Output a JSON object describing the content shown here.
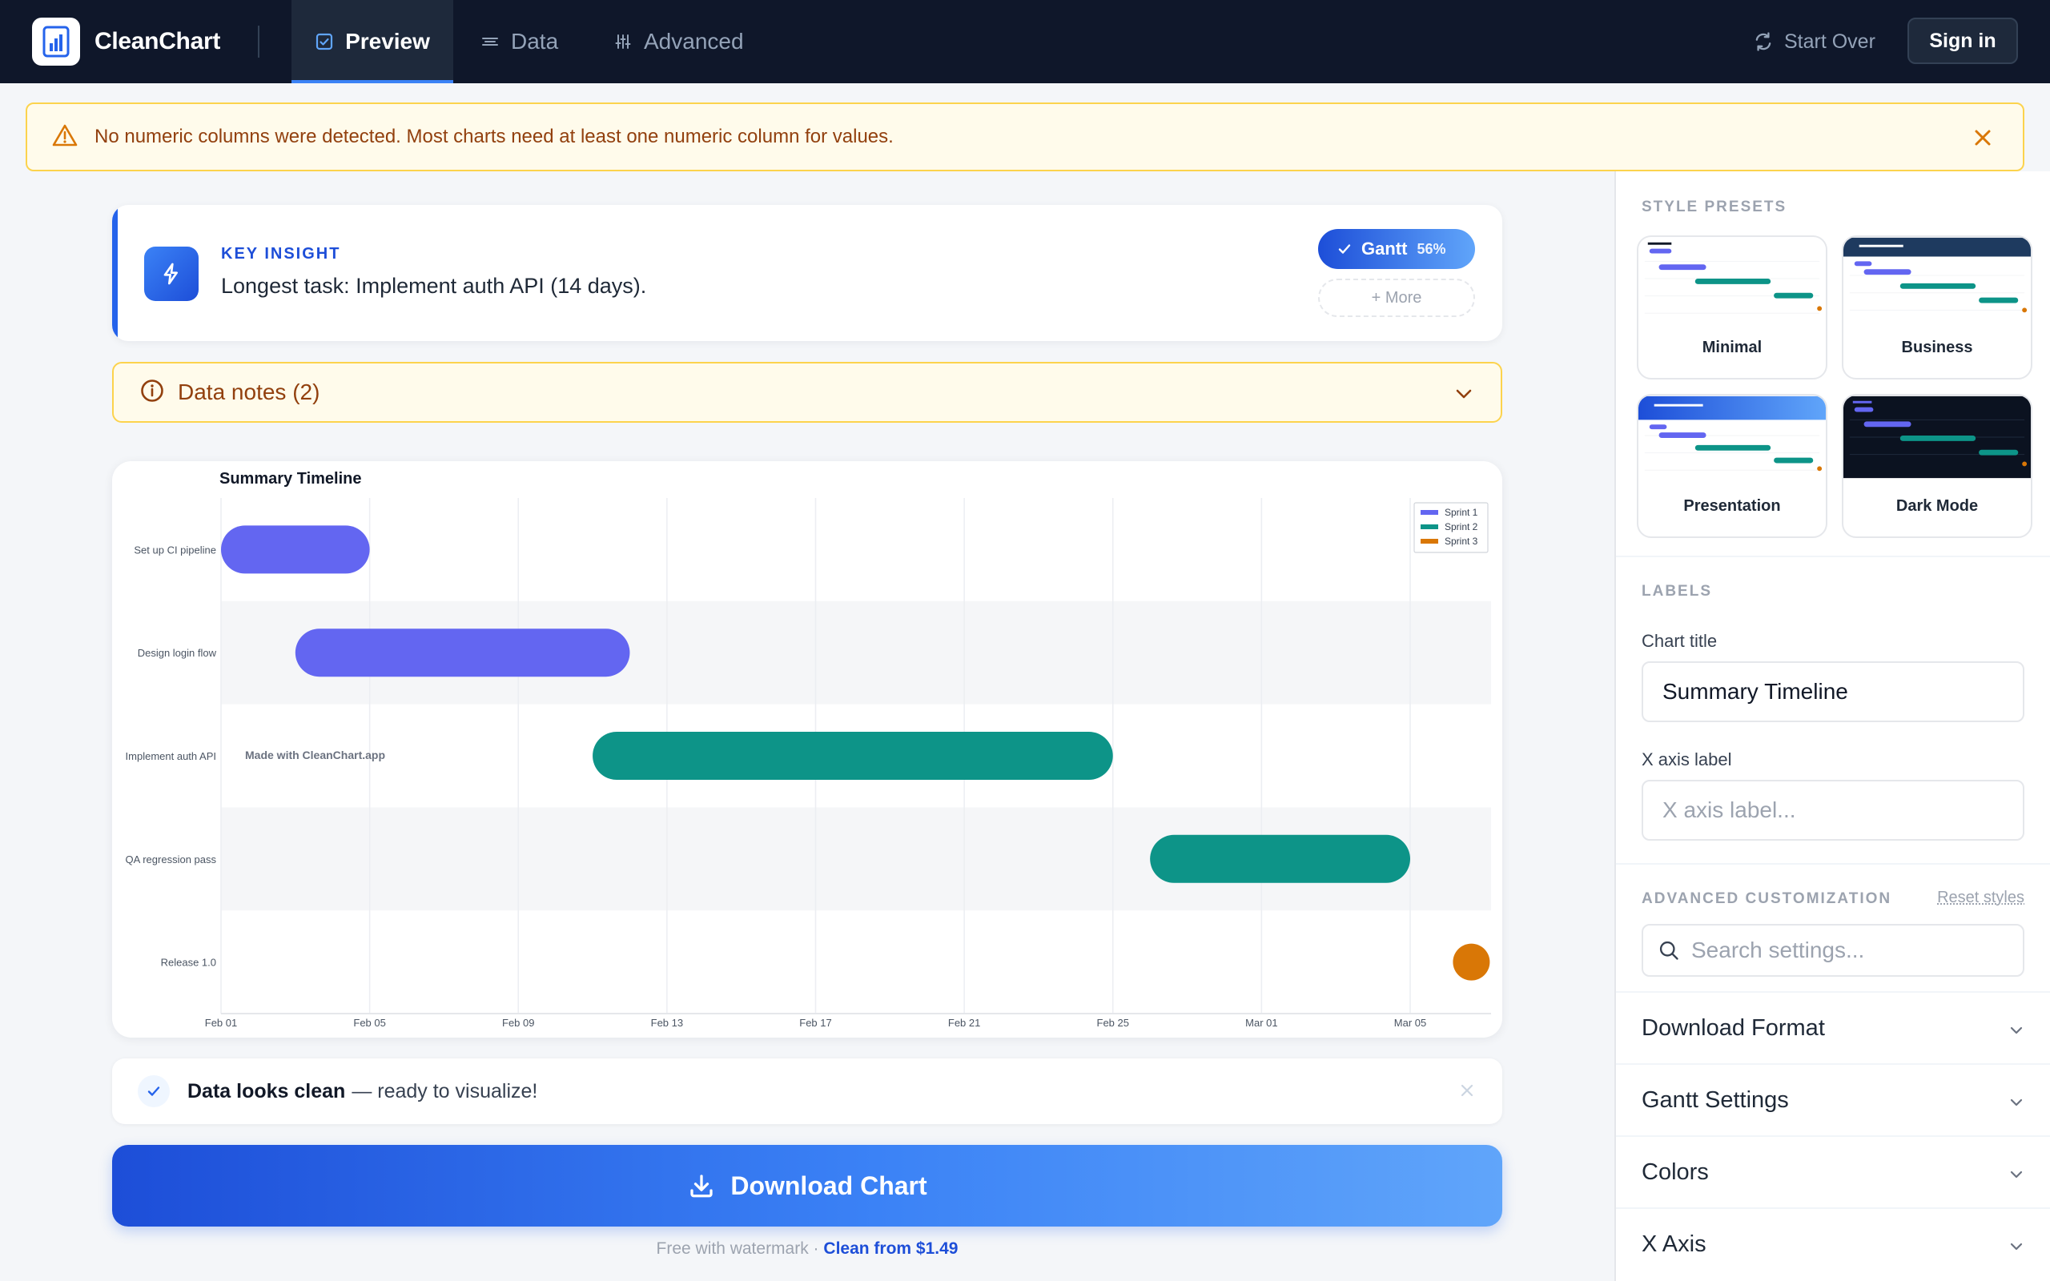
{
  "app": {
    "name": "CleanChart",
    "tabs": [
      {
        "label": "Preview",
        "icon": "check-square-icon",
        "active": true
      },
      {
        "label": "Data",
        "icon": "lines-icon",
        "active": false
      },
      {
        "label": "Advanced",
        "icon": "sliders-icon",
        "active": false
      }
    ],
    "start_over": "Start Over",
    "sign_in": "Sign in"
  },
  "warning": {
    "text": "No numeric columns were detected. Most charts need at least one numeric column for values."
  },
  "insight": {
    "kicker": "KEY INSIGHT",
    "text": "Longest task: Implement auth API (14 days).",
    "chart_pill": "Gantt",
    "chart_pct": "56%",
    "more": "+ More"
  },
  "notes": {
    "label": "Data notes (2)"
  },
  "chart_data": {
    "type": "gantt",
    "title": "Summary Timeline",
    "watermark": "Made with CleanChart.app",
    "x_ticks": [
      "Feb 01",
      "Feb 05",
      "Feb 09",
      "Feb 13",
      "Feb 17",
      "Feb 21",
      "Feb 25",
      "Mar 01",
      "Mar 05"
    ],
    "legend": [
      {
        "name": "Sprint 1",
        "color": "#6366f1"
      },
      {
        "name": "Sprint 2",
        "color": "#0d9488"
      },
      {
        "name": "Sprint 3",
        "color": "#d97706"
      }
    ],
    "tasks": [
      {
        "name": "Set up CI pipeline",
        "start": "Feb 01",
        "end": "Feb 05",
        "sprint": "Sprint 1"
      },
      {
        "name": "Design login flow",
        "start": "Feb 03",
        "end": "Feb 12",
        "sprint": "Sprint 1"
      },
      {
        "name": "Implement auth API",
        "start": "Feb 11",
        "end": "Feb 25",
        "sprint": "Sprint 2"
      },
      {
        "name": "QA regression pass",
        "start": "Feb 26",
        "end": "Mar 05",
        "sprint": "Sprint 2"
      },
      {
        "name": "Release 1.0",
        "start": "Mar 06",
        "end": "Mar 06",
        "sprint": "Sprint 3",
        "milestone": true
      }
    ],
    "grid": true,
    "legend_position": "top-right"
  },
  "clean_notice": {
    "strong": "Data looks clean",
    "rest": "— ready to visualize!"
  },
  "download": {
    "label": "Download Chart",
    "note": "Free with watermark ·",
    "note_cta": "Clean from $1.49"
  },
  "panel": {
    "style_presets_title": "STYLE PRESETS",
    "presets": [
      {
        "name": "Minimal"
      },
      {
        "name": "Business"
      },
      {
        "name": "Presentation"
      },
      {
        "name": "Dark Mode"
      }
    ],
    "labels_title": "LABELS",
    "chart_title_label": "Chart title",
    "chart_title_value": "Summary Timeline",
    "x_axis_label": "X axis label",
    "x_axis_placeholder": "X axis label...",
    "advanced_title": "ADVANCED CUSTOMIZATION",
    "reset_styles": "Reset styles",
    "search_placeholder": "Search settings...",
    "sections": [
      {
        "label": "Download Format"
      },
      {
        "label": "Gantt Settings"
      },
      {
        "label": "Colors"
      },
      {
        "label": "X Axis"
      }
    ]
  }
}
